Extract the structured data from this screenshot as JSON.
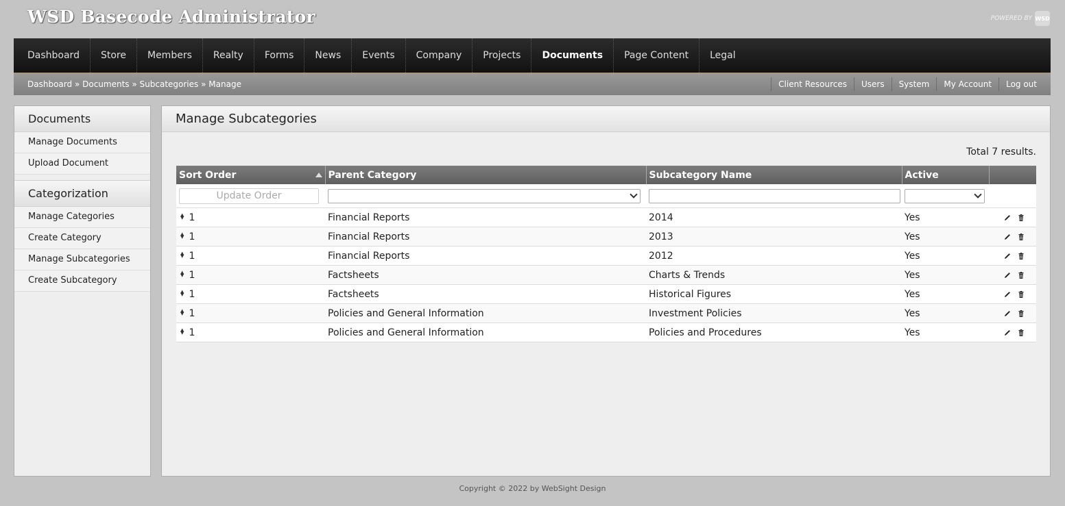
{
  "header": {
    "title": "WSD Basecode Administrator",
    "powered_by": "POWERED BY",
    "powered_badge": "WSD"
  },
  "nav": {
    "items": [
      {
        "label": "Dashboard"
      },
      {
        "label": "Store"
      },
      {
        "label": "Members"
      },
      {
        "label": "Realty"
      },
      {
        "label": "Forms"
      },
      {
        "label": "News"
      },
      {
        "label": "Events"
      },
      {
        "label": "Company"
      },
      {
        "label": "Projects"
      },
      {
        "label": "Documents",
        "active": true
      },
      {
        "label": "Page Content"
      },
      {
        "label": "Legal"
      }
    ]
  },
  "breadcrumb": {
    "items": [
      "Dashboard",
      "Documents",
      "Subcategories",
      "Manage"
    ],
    "separator": "»"
  },
  "utility": {
    "items": [
      "Client Resources",
      "Users",
      "System",
      "My Account",
      "Log out"
    ]
  },
  "sidebar": {
    "sections": [
      {
        "title": "Documents",
        "links": [
          "Manage Documents",
          "Upload Document"
        ]
      },
      {
        "title": "Categorization",
        "links": [
          "Manage Categories",
          "Create Category",
          "Manage Subcategories",
          "Create Subcategory"
        ]
      }
    ]
  },
  "main": {
    "title": "Manage Subcategories",
    "total": "Total 7 results.",
    "columns": [
      "Sort Order",
      "Parent Category",
      "Subcategory Name",
      "Active"
    ],
    "update_order_label": "Update Order",
    "rows": [
      {
        "order": "1",
        "parent": "Financial Reports",
        "name": "2014",
        "active": "Yes"
      },
      {
        "order": "1",
        "parent": "Financial Reports",
        "name": "2013",
        "active": "Yes"
      },
      {
        "order": "1",
        "parent": "Financial Reports",
        "name": "2012",
        "active": "Yes"
      },
      {
        "order": "1",
        "parent": "Factsheets",
        "name": "Charts & Trends",
        "active": "Yes"
      },
      {
        "order": "1",
        "parent": "Factsheets",
        "name": "Historical Figures",
        "active": "Yes"
      },
      {
        "order": "1",
        "parent": "Policies and General Information",
        "name": "Investment Policies",
        "active": "Yes"
      },
      {
        "order": "1",
        "parent": "Policies and General Information",
        "name": "Policies and Procedures",
        "active": "Yes"
      }
    ]
  },
  "footer": {
    "copyright": "Copyright © 2022 by WebSight Design"
  },
  "icons": {
    "row_actions": [
      "pencil-icon",
      "trash-icon"
    ],
    "drag": "sort-handle-icon"
  }
}
